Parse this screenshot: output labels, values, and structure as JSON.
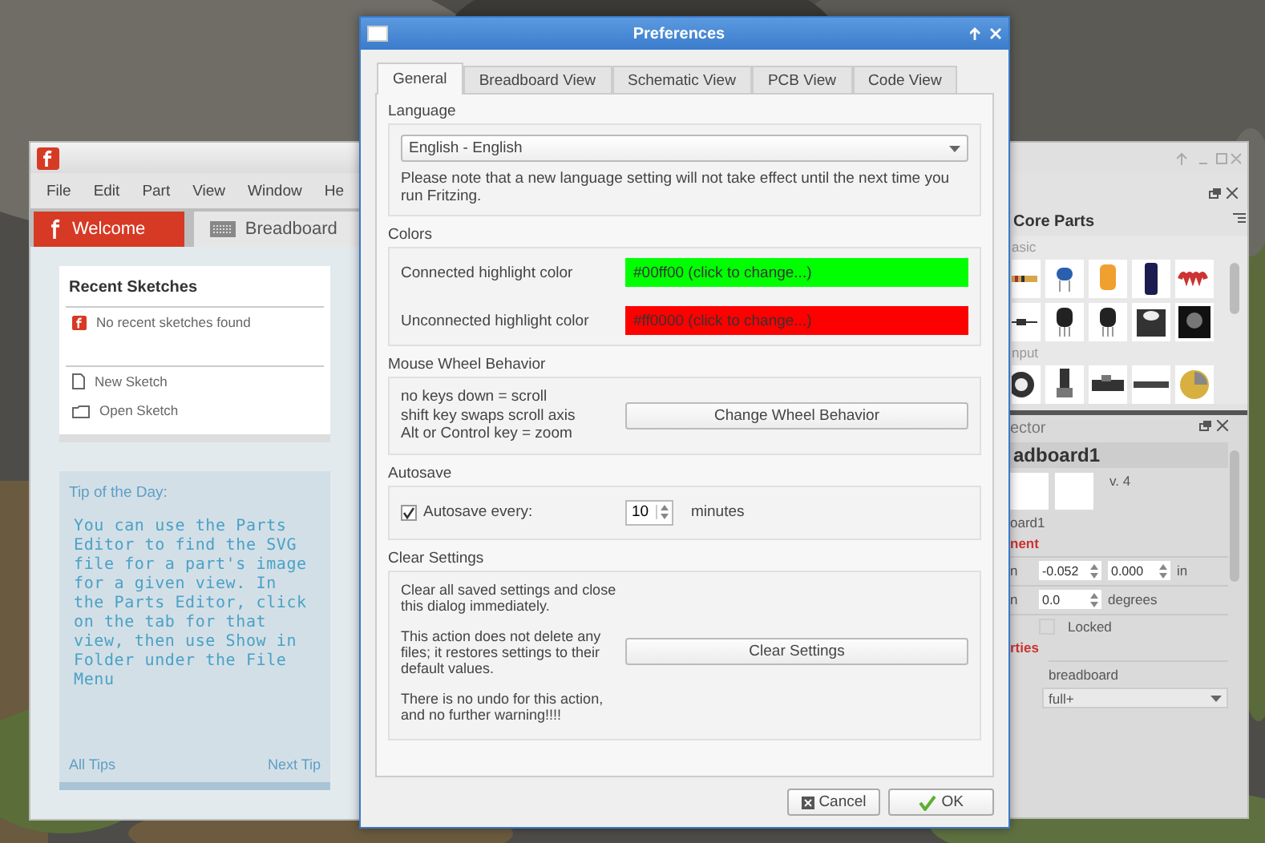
{
  "left_window": {
    "menu": [
      "File",
      "Edit",
      "Part",
      "View",
      "Window",
      "He"
    ],
    "tabs": [
      {
        "label": "Welcome",
        "selected": true
      },
      {
        "label": "Breadboard",
        "selected": false
      }
    ],
    "recent": {
      "title": "Recent Sketches",
      "empty": "No recent sketches found",
      "actions": [
        "New Sketch",
        "Open Sketch"
      ]
    },
    "tip": {
      "title": "Tip of the Day:",
      "text": "You can use the Parts Editor to find the SVG file for a part's image for a given view. In the Parts Editor, click on the tab for that view, then use Show in Folder under the File Menu",
      "links": [
        "All Tips",
        "Next Tip"
      ]
    }
  },
  "dialog": {
    "title": "Preferences",
    "tabs": [
      {
        "label": "General",
        "selected": true
      },
      {
        "label": "Breadboard View",
        "selected": false
      },
      {
        "label": "Schematic View",
        "selected": false
      },
      {
        "label": "PCB View",
        "selected": false
      },
      {
        "label": "Code View",
        "selected": false
      }
    ],
    "language": {
      "label": "Language",
      "value": "English - English",
      "note": "Please note that a new language setting will not take effect until the next time you run Fritzing."
    },
    "colors": {
      "label": "Colors",
      "rows": [
        {
          "label": "Connected highlight color",
          "value": "#00ff00 (click to change...)",
          "color": "#00ff00"
        },
        {
          "label": "Unconnected highlight color",
          "value": "#ff0000 (click to change...)",
          "color": "#ff0000"
        }
      ]
    },
    "wheel": {
      "label": "Mouse Wheel Behavior",
      "lines": [
        "no keys down = scroll",
        "shift key swaps scroll axis",
        "Alt or Control key = zoom"
      ],
      "button": "Change Wheel Behavior"
    },
    "autosave": {
      "label": "Autosave",
      "checkbox": "Autosave every:",
      "checked": true,
      "value": "10",
      "unit": "minutes"
    },
    "clear": {
      "label": "Clear Settings",
      "paragraphs": [
        "Clear all saved settings and close this dialog immediately.",
        "This action does not delete any files; it restores settings to their default values.",
        "There is no undo for this action, and no further warning!!!!"
      ],
      "button": "Clear Settings"
    },
    "buttons": [
      "Cancel",
      "OK"
    ]
  },
  "right_window": {
    "parts_title": "Core Parts",
    "sections": [
      "asic",
      "nput"
    ],
    "inspector": {
      "title": "ector",
      "name": "adboard1",
      "version": "v. 4",
      "subtitle": "oard1",
      "placement": "nent",
      "rows": [
        {
          "label": "n",
          "fields": [
            "-0.052",
            "0.000"
          ],
          "unit": "in"
        },
        {
          "label": "n",
          "fields": [
            "0.0"
          ],
          "unit": "degrees"
        }
      ],
      "locked": {
        "label": "Locked",
        "checked": false
      },
      "properties": "rties",
      "family": "breadboard",
      "select": "full+"
    }
  }
}
